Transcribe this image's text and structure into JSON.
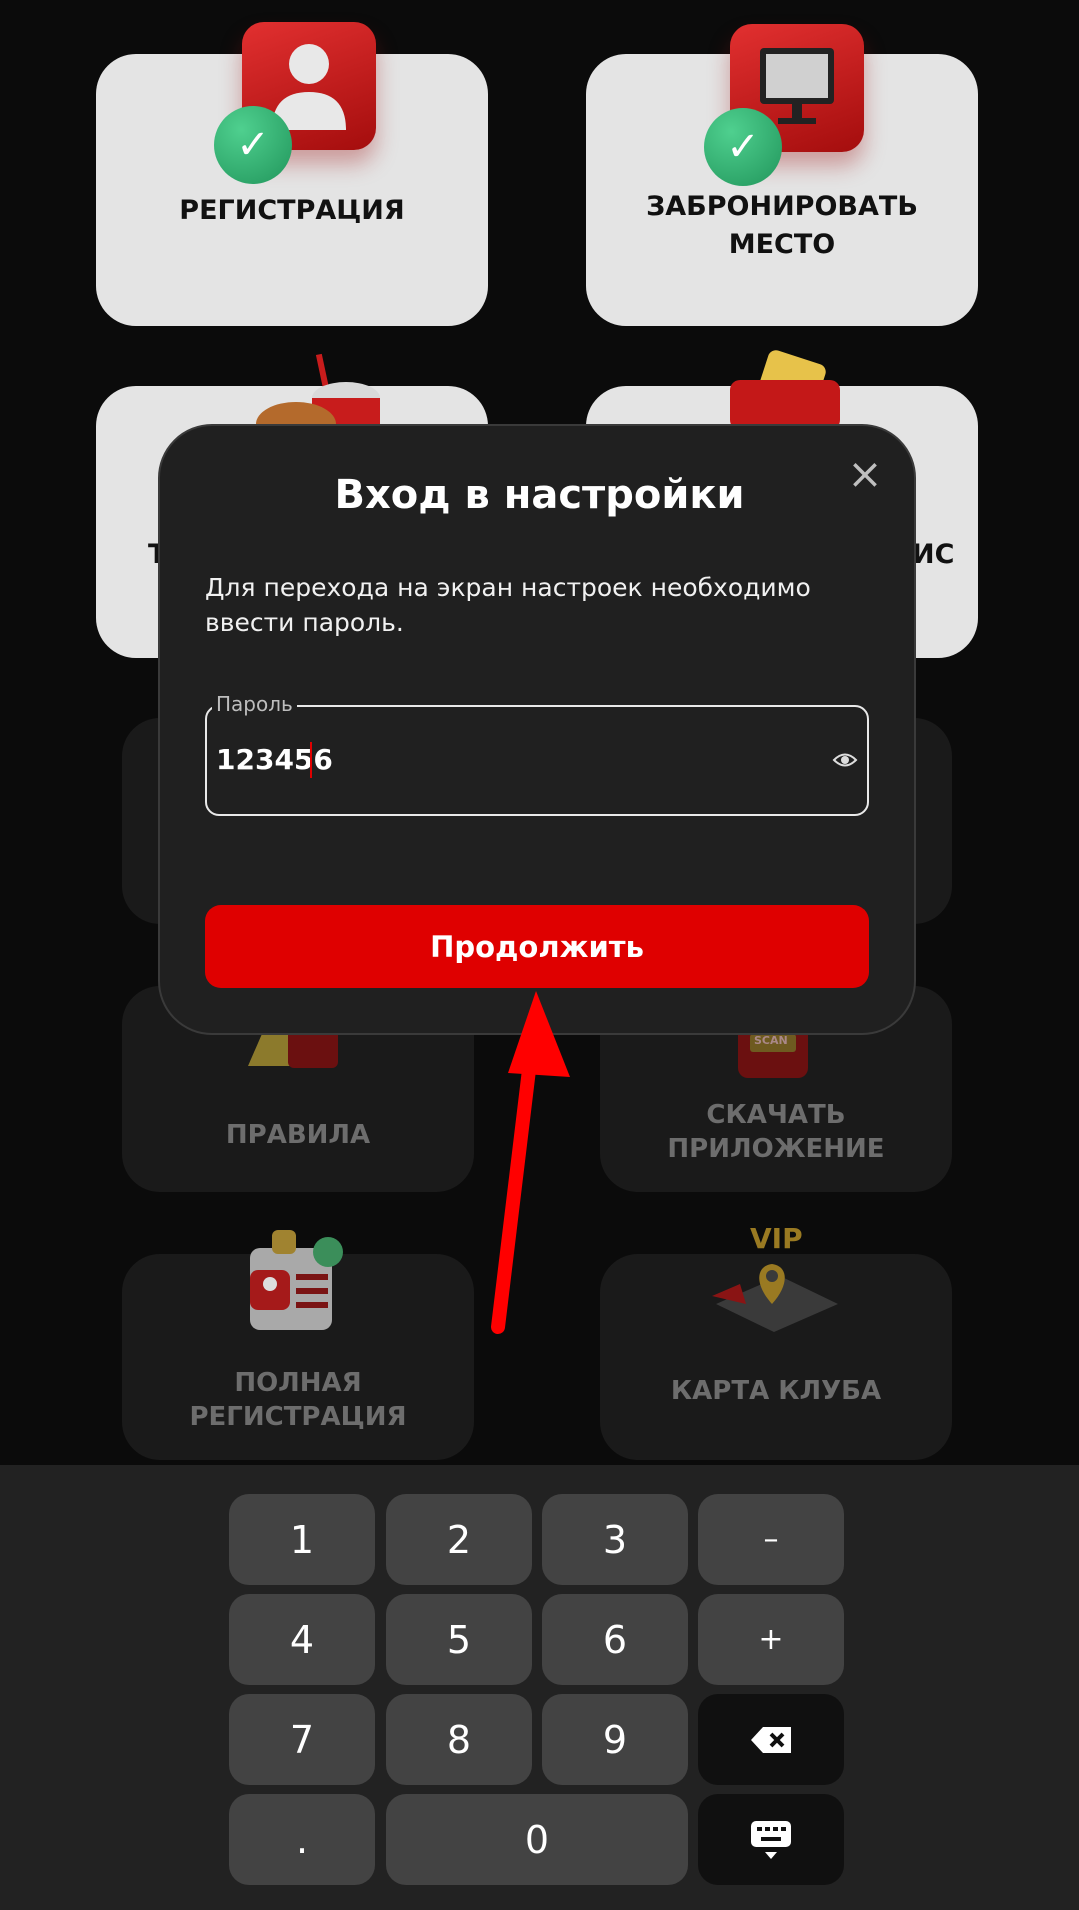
{
  "tiles": [
    {
      "label": "РЕГИСТРАЦИЯ"
    },
    {
      "label": "ЗАБРОНИРОВАТЬ\nМЕСТО"
    },
    {
      "label": "ПРАВИЛА"
    },
    {
      "label": "СКАЧАТЬ\nПРИЛОЖЕНИЕ"
    },
    {
      "label": "ПОЛНАЯ\nРЕГИСТРАЦИЯ"
    },
    {
      "label": "КАРТА КЛУБА"
    }
  ],
  "partial_text": {
    "left": "Т",
    "right": "ИС"
  },
  "badges": {
    "vip": "VIP",
    "scan": "SCAN"
  },
  "modal": {
    "title": "Вход в настройки",
    "description": "Для перехода на экран настроек необходимо ввести пароль.",
    "password_label": "Пароль",
    "password_value": "123456",
    "continue_label": "Продолжить"
  },
  "keypad": {
    "keys": [
      "1",
      "2",
      "3",
      "–",
      "4",
      "5",
      "6",
      "+",
      "7",
      "8",
      "9",
      ".",
      "0"
    ]
  },
  "colors": {
    "accent": "#df0000",
    "modal_bg": "#202020",
    "key_bg": "#434343"
  }
}
